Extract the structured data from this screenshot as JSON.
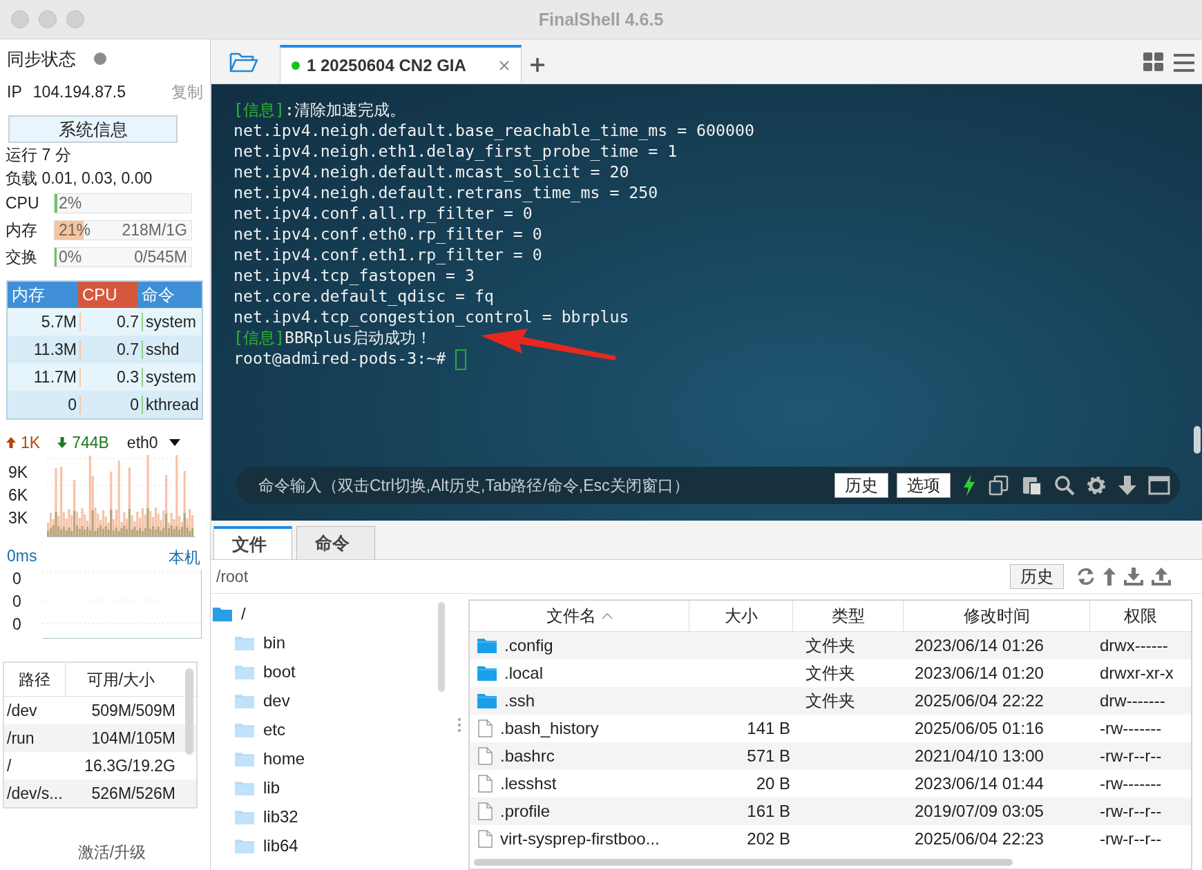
{
  "window": {
    "title": "FinalShell 4.6.5"
  },
  "sidebar": {
    "sync": {
      "label": "同步状态"
    },
    "ip": {
      "label": "IP",
      "value": "104.194.87.5",
      "copy": "复制"
    },
    "sysinfo_button": "系统信息",
    "uptime": "运行 7 分",
    "load": "负载 0.01, 0.03, 0.00",
    "meters": [
      {
        "label": "CPU",
        "percent": "2%",
        "level": 0.02,
        "color": "#6cc36c"
      },
      {
        "label": "内存",
        "percent": "21%",
        "detail": "218M/1G",
        "level": 0.21,
        "color": "#f7c49e"
      },
      {
        "label": "交换",
        "percent": "0%",
        "detail": "0/545M",
        "level": 0
      }
    ],
    "processes": {
      "columns": [
        {
          "label": "内存",
          "sorted": false
        },
        {
          "label": "CPU",
          "sorted": true
        },
        {
          "label": "命令",
          "sorted": false
        }
      ],
      "rows": [
        [
          "5.7M",
          "0.7",
          "system"
        ],
        [
          "11.3M",
          "0.7",
          "sshd"
        ],
        [
          "11.7M",
          "0.3",
          "system"
        ],
        [
          "0",
          "0",
          "kthread"
        ]
      ]
    },
    "network": {
      "up": "1K",
      "down": "744B",
      "interface": "eth0",
      "yticks": [
        "9K",
        "6K",
        "3K"
      ]
    },
    "latency": {
      "value": "0ms",
      "host": "本机",
      "yticks": [
        "0",
        "0",
        "0"
      ]
    },
    "disks": {
      "columns": [
        "路径",
        "可用/大小"
      ],
      "rows": [
        [
          "/dev",
          "509M/509M"
        ],
        [
          "/run",
          "104M/105M"
        ],
        [
          "/",
          "16.3G/19.2G"
        ],
        [
          "/dev/s...",
          "526M/526M"
        ]
      ]
    },
    "activate": "激活/升级"
  },
  "tabs": [
    {
      "label": "1 20250604 CN2 GIA",
      "selected": true,
      "connected": true
    }
  ],
  "terminal": {
    "lines": [
      {
        "kind": "info",
        "prefix": "[信息]",
        "text": ":清除加速完成。"
      },
      {
        "kind": "plain",
        "text": "net.ipv4.neigh.default.base_reachable_time_ms = 600000"
      },
      {
        "kind": "plain",
        "text": "net.ipv4.neigh.eth1.delay_first_probe_time = 1"
      },
      {
        "kind": "plain",
        "text": "net.ipv4.neigh.default.mcast_solicit = 20"
      },
      {
        "kind": "plain",
        "text": "net.ipv4.neigh.default.retrans_time_ms = 250"
      },
      {
        "kind": "plain",
        "text": "net.ipv4.conf.all.rp_filter = 0"
      },
      {
        "kind": "plain",
        "text": "net.ipv4.conf.eth0.rp_filter = 0"
      },
      {
        "kind": "plain",
        "text": "net.ipv4.conf.eth1.rp_filter = 0"
      },
      {
        "kind": "plain",
        "text": "net.ipv4.tcp_fastopen = 3"
      },
      {
        "kind": "plain",
        "text": "net.core.default_qdisc = fq"
      },
      {
        "kind": "plain",
        "text": "net.ipv4.tcp_congestion_control = bbrplus"
      },
      {
        "kind": "info",
        "prefix": "[信息]",
        "text": "BBRplus启动成功！"
      },
      {
        "kind": "prompt",
        "text": "root@admired-pods-3:~# "
      }
    ]
  },
  "command_bar": {
    "placeholder": "命令输入（双击Ctrl切换,Alt历史,Tab路径/命令,Esc关闭窗口）",
    "buttons": [
      "历史",
      "选项"
    ]
  },
  "bottom_tabs": [
    {
      "label": "文件",
      "selected": true
    },
    {
      "label": "命令",
      "selected": false
    }
  ],
  "path_bar": {
    "value": "/root",
    "history_button": "历史"
  },
  "tree": [
    {
      "name": "/",
      "children": [
        {
          "name": "bin"
        },
        {
          "name": "boot"
        },
        {
          "name": "dev"
        },
        {
          "name": "etc"
        },
        {
          "name": "home"
        },
        {
          "name": "lib"
        },
        {
          "name": "lib32"
        },
        {
          "name": "lib64"
        }
      ]
    }
  ],
  "files": {
    "columns": [
      {
        "label": "文件名",
        "sorted": true
      },
      {
        "label": "大小",
        "sorted": false
      },
      {
        "label": "类型",
        "sorted": false
      },
      {
        "label": "修改时间",
        "sorted": false
      },
      {
        "label": "权限",
        "sorted": false
      }
    ],
    "rows": [
      {
        "kind": "folder",
        "name": ".config",
        "size": "",
        "type": "文件夹",
        "mtime": "2023/06/14 01:26",
        "perms": "drwx------"
      },
      {
        "kind": "folder",
        "name": ".local",
        "size": "",
        "type": "文件夹",
        "mtime": "2023/06/14 01:20",
        "perms": "drwxr-xr-x"
      },
      {
        "kind": "folder",
        "name": ".ssh",
        "size": "",
        "type": "文件夹",
        "mtime": "2025/06/04 22:22",
        "perms": "drw-------"
      },
      {
        "kind": "file",
        "name": ".bash_history",
        "size": "141 B",
        "type": "",
        "mtime": "2025/06/05 01:16",
        "perms": "-rw-------"
      },
      {
        "kind": "file",
        "name": ".bashrc",
        "size": "571 B",
        "type": "",
        "mtime": "2021/04/10 13:00",
        "perms": "-rw-r--r--"
      },
      {
        "kind": "file",
        "name": ".lesshst",
        "size": "20 B",
        "type": "",
        "mtime": "2023/06/14 01:44",
        "perms": "-rw-------"
      },
      {
        "kind": "file",
        "name": ".profile",
        "size": "161 B",
        "type": "",
        "mtime": "2019/07/09 03:05",
        "perms": "-rw-r--r--"
      },
      {
        "kind": "file",
        "name": "virt-sysprep-firstboo...",
        "size": "202 B",
        "type": "",
        "mtime": "2025/06/04 22:23",
        "perms": "-rw-r--r--"
      }
    ]
  }
}
